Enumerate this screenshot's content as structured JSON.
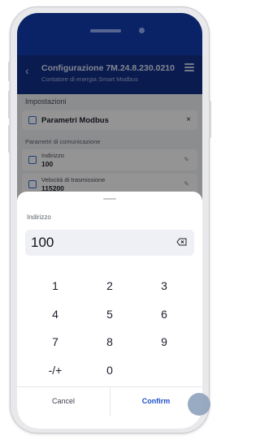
{
  "header": {
    "title": "Configurazione 7M.24.8.230.0210",
    "subtitle": "Contatore di energia Smart Modbus"
  },
  "settings": {
    "section_title": "Impostazioni",
    "modbus_title": "Parametri Modbus",
    "group_label": "Parametri di comunicazione",
    "fields": [
      {
        "label": "Indirizzo",
        "value": "100"
      },
      {
        "label": "Velocità di trasmissione",
        "value": "115200"
      }
    ]
  },
  "sheet": {
    "field_label": "Indirizzo",
    "value": "100",
    "keys": [
      "1",
      "2",
      "3",
      "4",
      "5",
      "6",
      "7",
      "8",
      "9",
      "-/+",
      "0"
    ],
    "cancel_label": "Cancel",
    "confirm_label": "Confirm"
  },
  "colors": {
    "header_bg": "#12308a",
    "accent": "#1e4fc9",
    "display_bg": "#eef0f6"
  }
}
